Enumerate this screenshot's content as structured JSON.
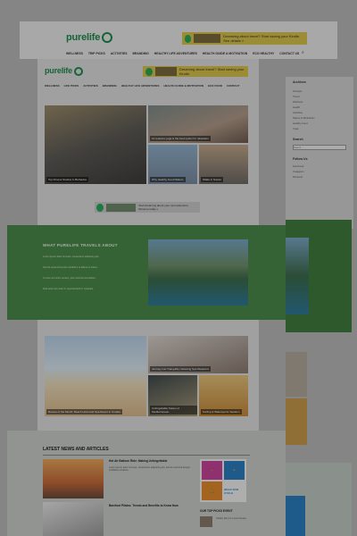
{
  "header": {
    "logo": "purelife",
    "banner_text": "Dreaming about travel? Start saving your Kindle. See details »",
    "nav": [
      "WELLNESS",
      "TRIP PICKS",
      "ACTIVITIES",
      "BRANDING",
      "HEALTHY LIFE ADVENTURES",
      "HEALTH GUIDE & MOTIVATION",
      "ECO HEALTHY",
      "CONTACT US"
    ],
    "search": "⌕"
  },
  "inner_header": {
    "logo": "purelife",
    "banner_text": "Dreaming about travel? Start saving your Kindle.",
    "nav": [
      "WELLNESS",
      "LIFE PICKS",
      "ACTIVITIES",
      "BRANDING",
      "HEALTHY LIFE ADVENTURES",
      "HEALTH GUIDE & MOTIVATION",
      "ECO FOOD",
      "CONTACT"
    ]
  },
  "sidebar": {
    "title": "Archives",
    "items": [
      "Lifestyle",
      "Travel",
      "Wellness",
      "Health",
      "Activities",
      "Nature & Motivation",
      "Healthy Food",
      "Yoga"
    ],
    "search_title": "Search",
    "search_placeholder": "Search ...",
    "follow_title": "Follow Us",
    "follow_items": [
      "Facebook",
      "Instagram",
      "Pinterest"
    ]
  },
  "grid_top": {
    "big_caption": "Top Fitness Studios in Barbados",
    "right_top_caption": "10 reasons yoga is the best option for relaxation",
    "right_bottom_left_caption": "Why Healthy Food Matters",
    "right_bottom_right_caption": "Walks in Nature"
  },
  "mid_banner": {
    "text": "Start dreaming about your next adventure. Reserve today »"
  },
  "band": {
    "title": "WHAT PURELIFE TRAVELS ABOUT",
    "lines": [
      "Lorem ipsum dolor sit amet, consectetur adipiscing elit.",
      "Sed do eiusmod tempor incididunt ut labore et dolore.",
      "Ut enim ad minim veniam, quis nostrud exercitation.",
      "Duis aute irure dolor in reprehenderit in voluptate."
    ]
  },
  "grid_bottom": {
    "big_caption": "Review of the Month: Beach Hotel and Spa Resort in Croatia",
    "right_top_caption": "Journey into Tranquility: Relaxing Spa Weekend",
    "right_bottom_left_caption": "Unforgettable Tastes of Mediterranean",
    "right_bottom_right_caption": "Surfing & Watersports Vacation"
  },
  "news": {
    "title": "LATEST NEWS AND ARTICLES",
    "article1_title": "Hot Air Balloon Ride: Making Unforgettable",
    "article1_text": "Lorem ipsum dolor sit amet, consectetur adipiscing elit, sed do eiusmod tempor incididunt ut labore.",
    "article2_title": "Barefoot Pilates: Trends and Benefits to Know Now",
    "walk_label": "WALK RUN CYCLE",
    "top_title": "OUR TOP PICKS EVENT",
    "top_item": "Charity Run for Local Causes"
  }
}
